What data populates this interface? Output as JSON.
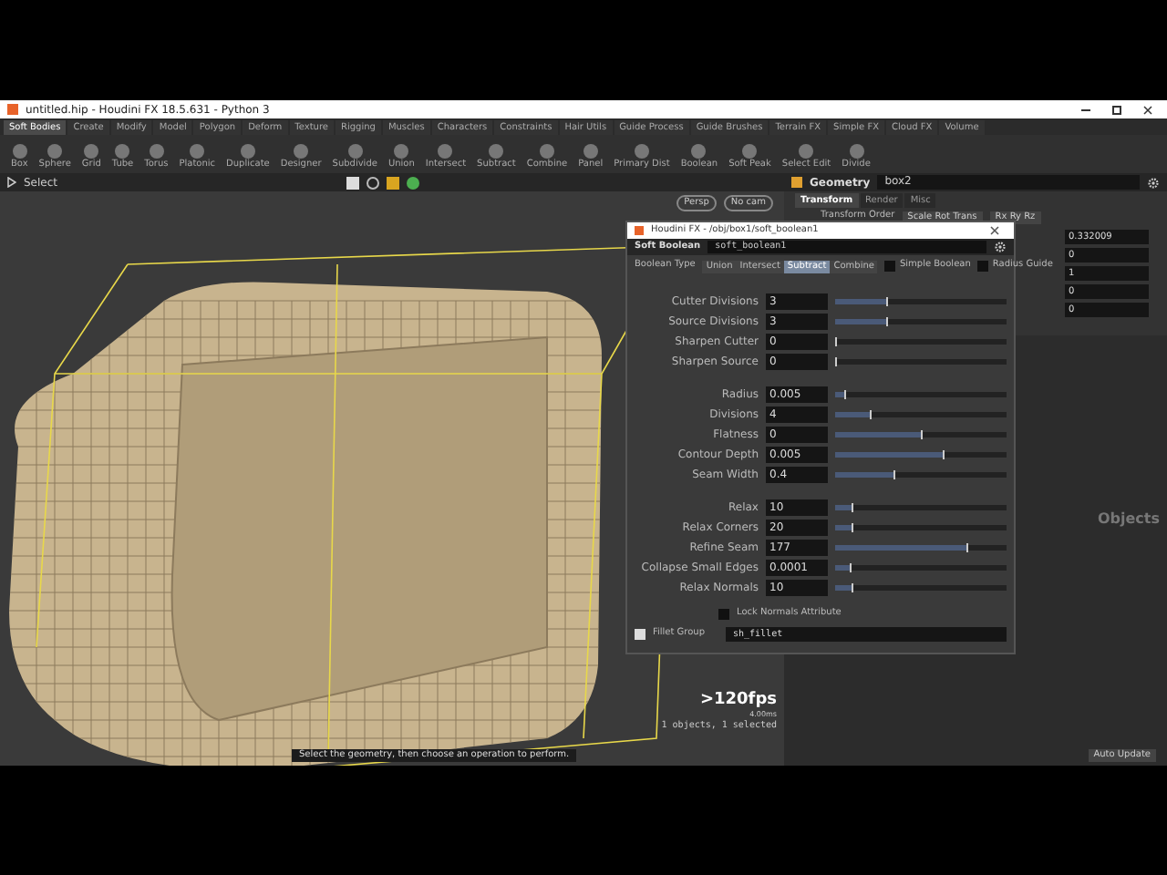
{
  "window": {
    "title": "untitled.hip - Houdini FX 18.5.631 - Python 3"
  },
  "shelf_tabs": [
    {
      "label": "Soft Bodies",
      "selected": true
    },
    {
      "label": "Create",
      "selected": false
    },
    {
      "label": "Modify",
      "selected": false
    },
    {
      "label": "Model",
      "selected": false
    },
    {
      "label": "Polygon",
      "selected": false
    },
    {
      "label": "Deform",
      "selected": false
    },
    {
      "label": "Texture",
      "selected": false
    },
    {
      "label": "Rigging",
      "selected": false
    },
    {
      "label": "Muscles",
      "selected": false
    },
    {
      "label": "Characters",
      "selected": false
    },
    {
      "label": "Constraints",
      "selected": false
    },
    {
      "label": "Hair Utils",
      "selected": false
    },
    {
      "label": "Guide Process",
      "selected": false
    },
    {
      "label": "Guide Brushes",
      "selected": false
    },
    {
      "label": "Terrain FX",
      "selected": false
    },
    {
      "label": "Simple FX",
      "selected": false
    },
    {
      "label": "Cloud FX",
      "selected": false
    },
    {
      "label": "Volume",
      "selected": false
    }
  ],
  "shelf_tools": [
    "Box",
    "Sphere",
    "Grid",
    "Tube",
    "Torus",
    "Platonic",
    "Duplicate",
    "Designer",
    "Subdivide",
    "Union",
    "Intersect",
    "Subtract",
    "Combine",
    "Panel",
    "Primary Dist",
    "Boolean",
    "Soft Peak",
    "Select Edit",
    "Divide"
  ],
  "viewport": {
    "tool": "Select",
    "camera_buttons": [
      "Persp",
      "No cam"
    ],
    "fps": ">120fps",
    "timing": "4.00ms",
    "selection_info": "1 objects, 1 selected",
    "hint": "Select the geometry, then choose an operation to perform."
  },
  "path_bar": {
    "node_type": "Geometry",
    "node_name": "box2"
  },
  "transform_panel": {
    "tabs": [
      {
        "label": "Transform",
        "selected": true
      },
      {
        "label": "Render",
        "selected": false
      },
      {
        "label": "Misc",
        "selected": false
      }
    ],
    "transform_order_label": "Transform Order",
    "orders": [
      "Scale Rot Trans",
      "Rx Ry Rz"
    ],
    "values": [
      "0.332009",
      "0",
      "1",
      "0",
      "0"
    ]
  },
  "network": {
    "label": "Objects",
    "auto_update": "Auto Update"
  },
  "dialog": {
    "title": "Houdini FX - /obj/box1/soft_boolean1",
    "node_type": "Soft Boolean",
    "node_name": "soft_boolean1",
    "boolean_type_label": "Boolean Type",
    "boolean_types": [
      {
        "label": "Union",
        "selected": false
      },
      {
        "label": "Intersect",
        "selected": false
      },
      {
        "label": "Subtract",
        "selected": true
      },
      {
        "label": "Combine",
        "selected": false
      }
    ],
    "toggles": [
      {
        "label": "Simple Boolean",
        "checked": false
      },
      {
        "label": "Radius Guide",
        "checked": false
      }
    ],
    "groups": [
      [
        {
          "label": "Cutter Divisions",
          "value": "3",
          "level": 0.3
        },
        {
          "label": "Source Divisions",
          "value": "3",
          "level": 0.3
        },
        {
          "label": "Sharpen Cutter",
          "value": "0",
          "level": 0
        },
        {
          "label": "Sharpen Source",
          "value": "0",
          "level": 0
        }
      ],
      [
        {
          "label": "Radius",
          "value": "0.005",
          "level": 0.05
        },
        {
          "label": "Divisions",
          "value": "4",
          "level": 0.2
        },
        {
          "label": "Flatness",
          "value": "0",
          "level": 0.5
        },
        {
          "label": "Contour Depth",
          "value": "0.005",
          "level": 0.63
        },
        {
          "label": "Seam Width",
          "value": "0.4",
          "level": 0.34
        }
      ],
      [
        {
          "label": "Relax",
          "value": "10",
          "level": 0.1
        },
        {
          "label": "Relax Corners",
          "value": "20",
          "level": 0.1
        },
        {
          "label": "Refine Seam",
          "value": "177",
          "level": 0.77
        },
        {
          "label": "Collapse Small Edges",
          "value": "0.0001",
          "level": 0.08
        },
        {
          "label": "Relax Normals",
          "value": "10",
          "level": 0.1
        }
      ]
    ],
    "lock_normals": {
      "label": "Lock Normals Attribute",
      "checked": false
    },
    "fillet_group": {
      "label": "Fillet Group",
      "value": "sh_fillet",
      "checked": true
    }
  }
}
